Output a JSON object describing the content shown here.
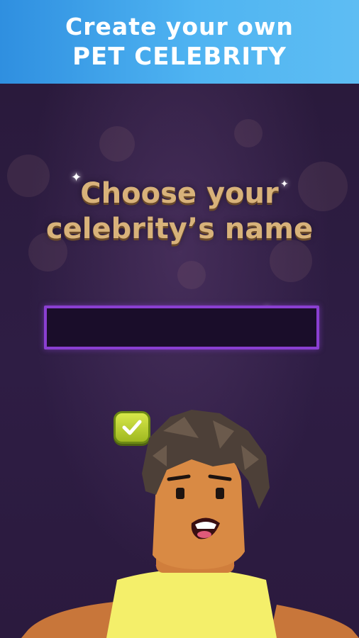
{
  "banner": {
    "line1": "Create your own",
    "line2": "PET CELEBRITY"
  },
  "main": {
    "title_line1": "Choose your",
    "title_line2": "celebrity’s name",
    "name_input": {
      "value": "",
      "placeholder": ""
    }
  },
  "colors": {
    "banner_blue": "#4fb4f2",
    "background_purple": "#2b1a3e",
    "title_gold": "#d8b27a",
    "input_border": "#8a3fd1",
    "confirm_green": "#b8d030",
    "shirt_yellow": "#f4ef6a"
  },
  "icons": {
    "confirm": "checkmark-icon"
  }
}
